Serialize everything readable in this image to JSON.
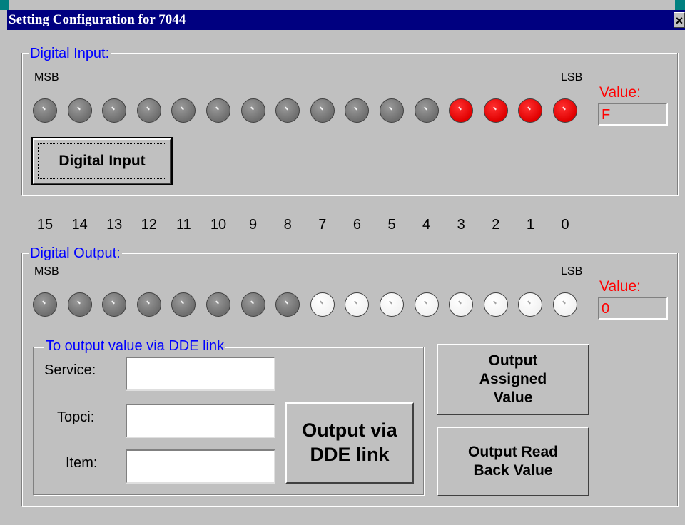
{
  "window": {
    "title": "Setting Configuration for 7044",
    "close_glyph": "×"
  },
  "digital_input": {
    "group_label": "Digital Input:",
    "msb_label": "MSB",
    "lsb_label": "LSB",
    "value_label": "Value:",
    "value": "F",
    "button_label": "Digital Input",
    "leds": [
      "off",
      "off",
      "off",
      "off",
      "off",
      "off",
      "off",
      "off",
      "off",
      "off",
      "off",
      "off",
      "on",
      "on",
      "on",
      "on"
    ]
  },
  "bit_numbers": [
    "15",
    "14",
    "13",
    "12",
    "11",
    "10",
    "9",
    "8",
    "7",
    "6",
    "5",
    "4",
    "3",
    "2",
    "1",
    "0"
  ],
  "digital_output": {
    "group_label": "Digital Output:",
    "msb_label": "MSB",
    "lsb_label": "LSB",
    "value_label": "Value:",
    "value": "0",
    "leds": [
      "off",
      "off",
      "off",
      "off",
      "off",
      "off",
      "off",
      "off",
      "white",
      "white",
      "white",
      "white",
      "white",
      "white",
      "white",
      "white"
    ]
  },
  "dde": {
    "group_label": "To output value via DDE link",
    "service_label": "Service:",
    "service_value": "",
    "topic_label": "Topci:",
    "topic_value": "",
    "item_label": "Item:",
    "item_value": "",
    "output_button_line1": "Output via",
    "output_button_line2": "DDE link"
  },
  "buttons": {
    "output_assigned_line1": "Output",
    "output_assigned_line2": "Assigned",
    "output_assigned_line3": "Value",
    "output_readback_line1": "Output Read",
    "output_readback_line2": "Back Value"
  },
  "colors": {
    "led_on": "#ff0000",
    "led_off": "#808080",
    "led_white": "#ffffff",
    "label_blue": "#0000ff",
    "value_red": "#ff0000",
    "titlebar": "#000080"
  }
}
